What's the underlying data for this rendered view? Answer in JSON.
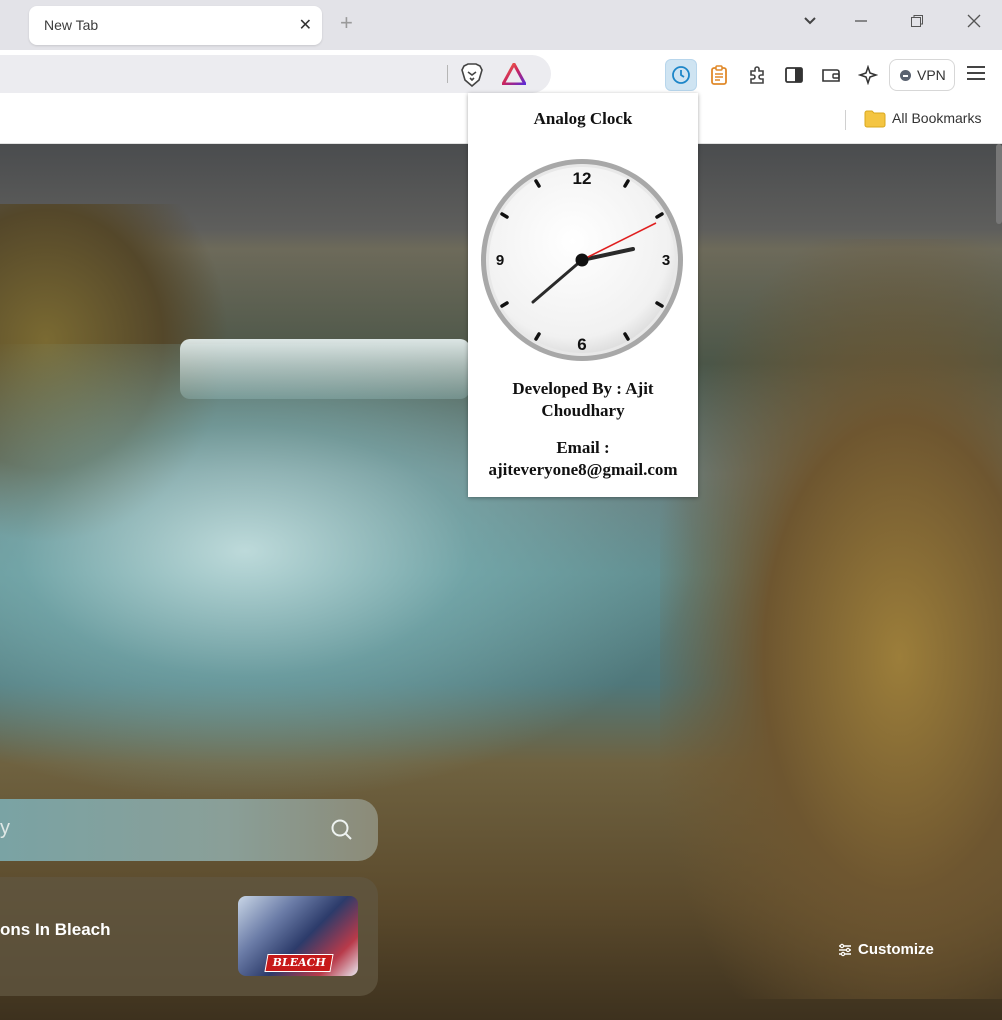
{
  "tabs": [
    {
      "title": "New Tab",
      "close_glyph": "✕"
    }
  ],
  "new_tab_glyph": "+",
  "window_controls": {
    "dropdown": "⌄",
    "minimize": "—",
    "restore": "❐",
    "close": "✕"
  },
  "toolbar": {
    "vpn_label": "VPN",
    "buttons": [
      "clock-extension-icon",
      "notes-extension-icon",
      "extensions-puzzle-icon",
      "sidebar-icon",
      "wallet-icon",
      "leo-ai-icon"
    ],
    "active_color": "#cfe4f2"
  },
  "bookmarks": {
    "all_bookmarks_label": "All Bookmarks"
  },
  "popup": {
    "title": "Analog Clock",
    "clock_numbers": {
      "twelve": "12",
      "three": "3",
      "six": "6",
      "nine": "9"
    },
    "developed_by": "Developed By : Ajit Choudhary",
    "email_label": "Email :",
    "email": "ajiteveryone8@gmail.com",
    "second_hand_color": "#e02020"
  },
  "newtab_page": {
    "search_placeholder": "y",
    "card_title": "ons In Bleach",
    "card_thumb_logo": "BLEACH",
    "customize_label": "Customize"
  }
}
